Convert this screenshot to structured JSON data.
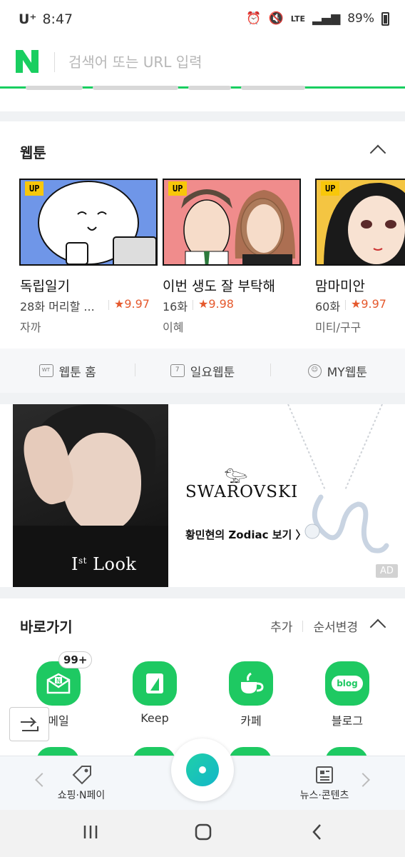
{
  "status_bar": {
    "carrier": "U⁺",
    "time": "8:47",
    "network": "LTE",
    "battery": "89%"
  },
  "search": {
    "placeholder": "검색어 또는 URL 입력"
  },
  "webtoon": {
    "title": "웹툰",
    "items": [
      {
        "badge": "UP",
        "title": "독립일기",
        "episode": "28화 머리할 ...",
        "rating": "★9.97",
        "author": "자까"
      },
      {
        "badge": "UP",
        "title": "이번 생도 잘 부탁해",
        "episode": "16화",
        "rating": "★9.98",
        "author": "이혜"
      },
      {
        "badge": "UP",
        "title": "맘마미안",
        "episode": "60화",
        "rating": "★9.97",
        "author": "미티/구구"
      }
    ],
    "links": [
      {
        "label": "웹툰 홈",
        "icon": "webtoon-home-icon"
      },
      {
        "label": "일요웹툰",
        "icon": "calendar-icon",
        "icon_text": "7"
      },
      {
        "label": "MY웹툰",
        "icon": "smile-icon"
      }
    ]
  },
  "ad": {
    "photo_caption_main": "I",
    "photo_caption_sup": "st",
    "photo_caption_end": " Look",
    "brand": "SWAROVSKI",
    "cta": "황민현의 Zodiac 보기 〉",
    "badge": "AD"
  },
  "shortcuts": {
    "title": "바로가기",
    "add_label": "추가",
    "reorder_label": "순서변경",
    "mail_badge": "99+",
    "apps": [
      {
        "label": "메일",
        "icon": "mail-icon"
      },
      {
        "label": "Keep",
        "icon": "keep-icon"
      },
      {
        "label": "카페",
        "icon": "cafe-icon"
      },
      {
        "label": "블로그",
        "icon": "blog-icon",
        "icon_text": "blog"
      }
    ]
  },
  "dock": {
    "left_label": "쇼핑·N페이",
    "right_label": "뉴스·콘텐츠"
  },
  "colors": {
    "naver_green": "#19ce60",
    "rating_orange": "#e5592d",
    "up_badge": "#f8c70a"
  }
}
